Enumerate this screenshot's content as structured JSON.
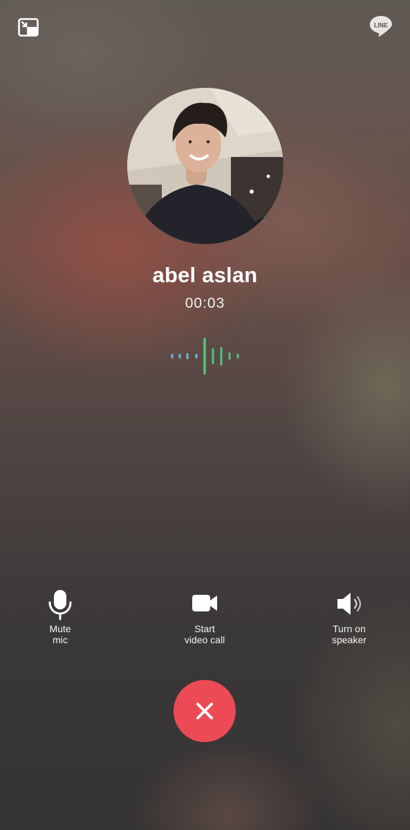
{
  "call": {
    "caller_name": "abel aslan",
    "duration": "00:03"
  },
  "icons": {
    "minimize": "picture-in-picture-icon",
    "brand": "line-logo-icon",
    "mute": "microphone-icon",
    "video": "video-camera-icon",
    "speaker": "speaker-icon",
    "end": "close-icon"
  },
  "brand_logo_text": "LINE",
  "controls": {
    "mute": {
      "line1": "Mute",
      "line2": "mic"
    },
    "video": {
      "line1": "Start",
      "line2": "video call"
    },
    "speaker": {
      "line1": "Turn on",
      "line2": "speaker"
    }
  },
  "colors": {
    "end_call_button": "#ec4a55",
    "wave_blue": "#6fb6d8",
    "wave_green": "#4cc77d"
  }
}
